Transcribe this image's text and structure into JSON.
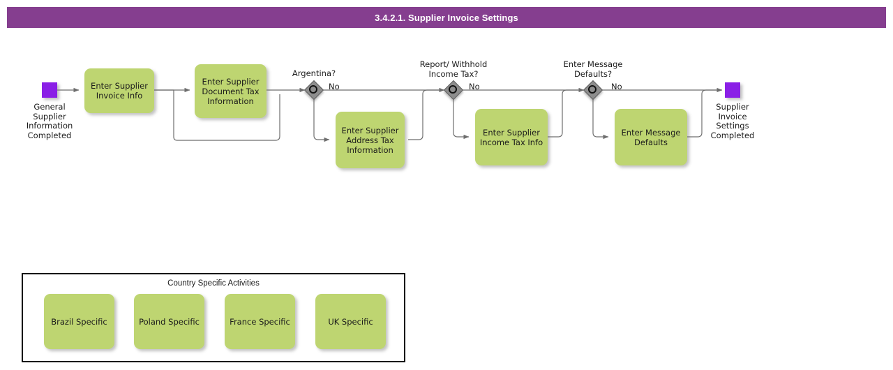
{
  "header": {
    "title": "3.4.2.1. Supplier Invoice Settings",
    "bar_color": "#853e8f",
    "text_color": "#ffffff"
  },
  "theme": {
    "task_fill": "#bed571",
    "event_fill": "#8a1fe6",
    "gateway_fill": "#8d8d8d",
    "connector_color": "#6e6e6e",
    "group_border": "#000000"
  },
  "diagram": {
    "type": "bpmn-process-flow",
    "start_event": {
      "name": "start-event",
      "label": "General\nSupplier\nInformation\nCompleted"
    },
    "end_event": {
      "name": "end-event",
      "label": "Supplier\nInvoice\nSettings\nCompleted"
    },
    "tasks": [
      {
        "id": "enter-supplier-invoice-info",
        "label": "Enter Supplier\nInvoice Info"
      },
      {
        "id": "enter-supplier-document-tax-information",
        "label": "Enter Supplier\nDocument Tax\nInformation"
      },
      {
        "id": "enter-supplier-address-tax-information",
        "label": "Enter Supplier\nAddress Tax\nInformation"
      },
      {
        "id": "enter-supplier-income-tax-info",
        "label": "Enter Supplier\nIncome Tax Info"
      },
      {
        "id": "enter-message-defaults",
        "label": "Enter Message\nDefaults"
      }
    ],
    "gateways": [
      {
        "id": "gateway-argentina",
        "label": "Argentina?",
        "branch_label": "No"
      },
      {
        "id": "gateway-report-withhold-income-tax",
        "label": "Report/ Withhold\nIncome Tax?",
        "branch_label": "No"
      },
      {
        "id": "gateway-enter-message-defaults",
        "label": "Enter Message\nDefaults?",
        "branch_label": "No"
      }
    ]
  },
  "country_group": {
    "title": "Country Specific Activities",
    "items": [
      {
        "id": "brazil-specific",
        "label": "Brazil Specific"
      },
      {
        "id": "poland-specific",
        "label": "Poland Specific"
      },
      {
        "id": "france-specific",
        "label": "France Specific"
      },
      {
        "id": "uk-specific",
        "label": "UK Specific"
      }
    ]
  }
}
